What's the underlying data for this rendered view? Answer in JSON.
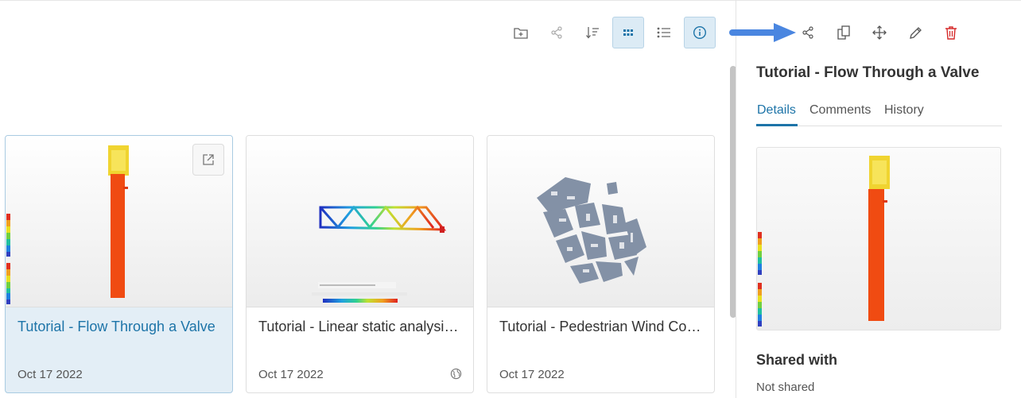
{
  "toolbar": {
    "buttons": [
      {
        "icon": "new-folder-icon",
        "active": false
      },
      {
        "icon": "share-icon",
        "active": false
      },
      {
        "icon": "sort-icon",
        "active": false
      },
      {
        "icon": "grid-view-icon",
        "active": true
      },
      {
        "icon": "list-view-icon",
        "active": false
      },
      {
        "icon": "info-icon",
        "active": true
      }
    ],
    "accent_color": "#1d74a8"
  },
  "cards": [
    {
      "title": "Tutorial - Flow Through a Valve",
      "date": "Oct 17 2022",
      "selected": true
    },
    {
      "title": "Tutorial - Linear static analysis of a Crane",
      "date": "Oct 17 2022",
      "selected": false,
      "public": true
    },
    {
      "title": "Tutorial - Pedestrian Wind Comfort",
      "date": "Oct 17 2022",
      "selected": false
    }
  ],
  "panel": {
    "actions": [
      "share-icon",
      "copy-icon",
      "move-icon",
      "edit-icon",
      "delete-icon"
    ],
    "delete_color": "#d62b2b",
    "title": "Tutorial - Flow Through a Valve",
    "tabs": [
      "Details",
      "Comments",
      "History"
    ],
    "active_tab": "Details",
    "shared_heading": "Shared with",
    "shared_value": "Not shared"
  },
  "annotation": {
    "arrow_color": "#4a86e0"
  }
}
